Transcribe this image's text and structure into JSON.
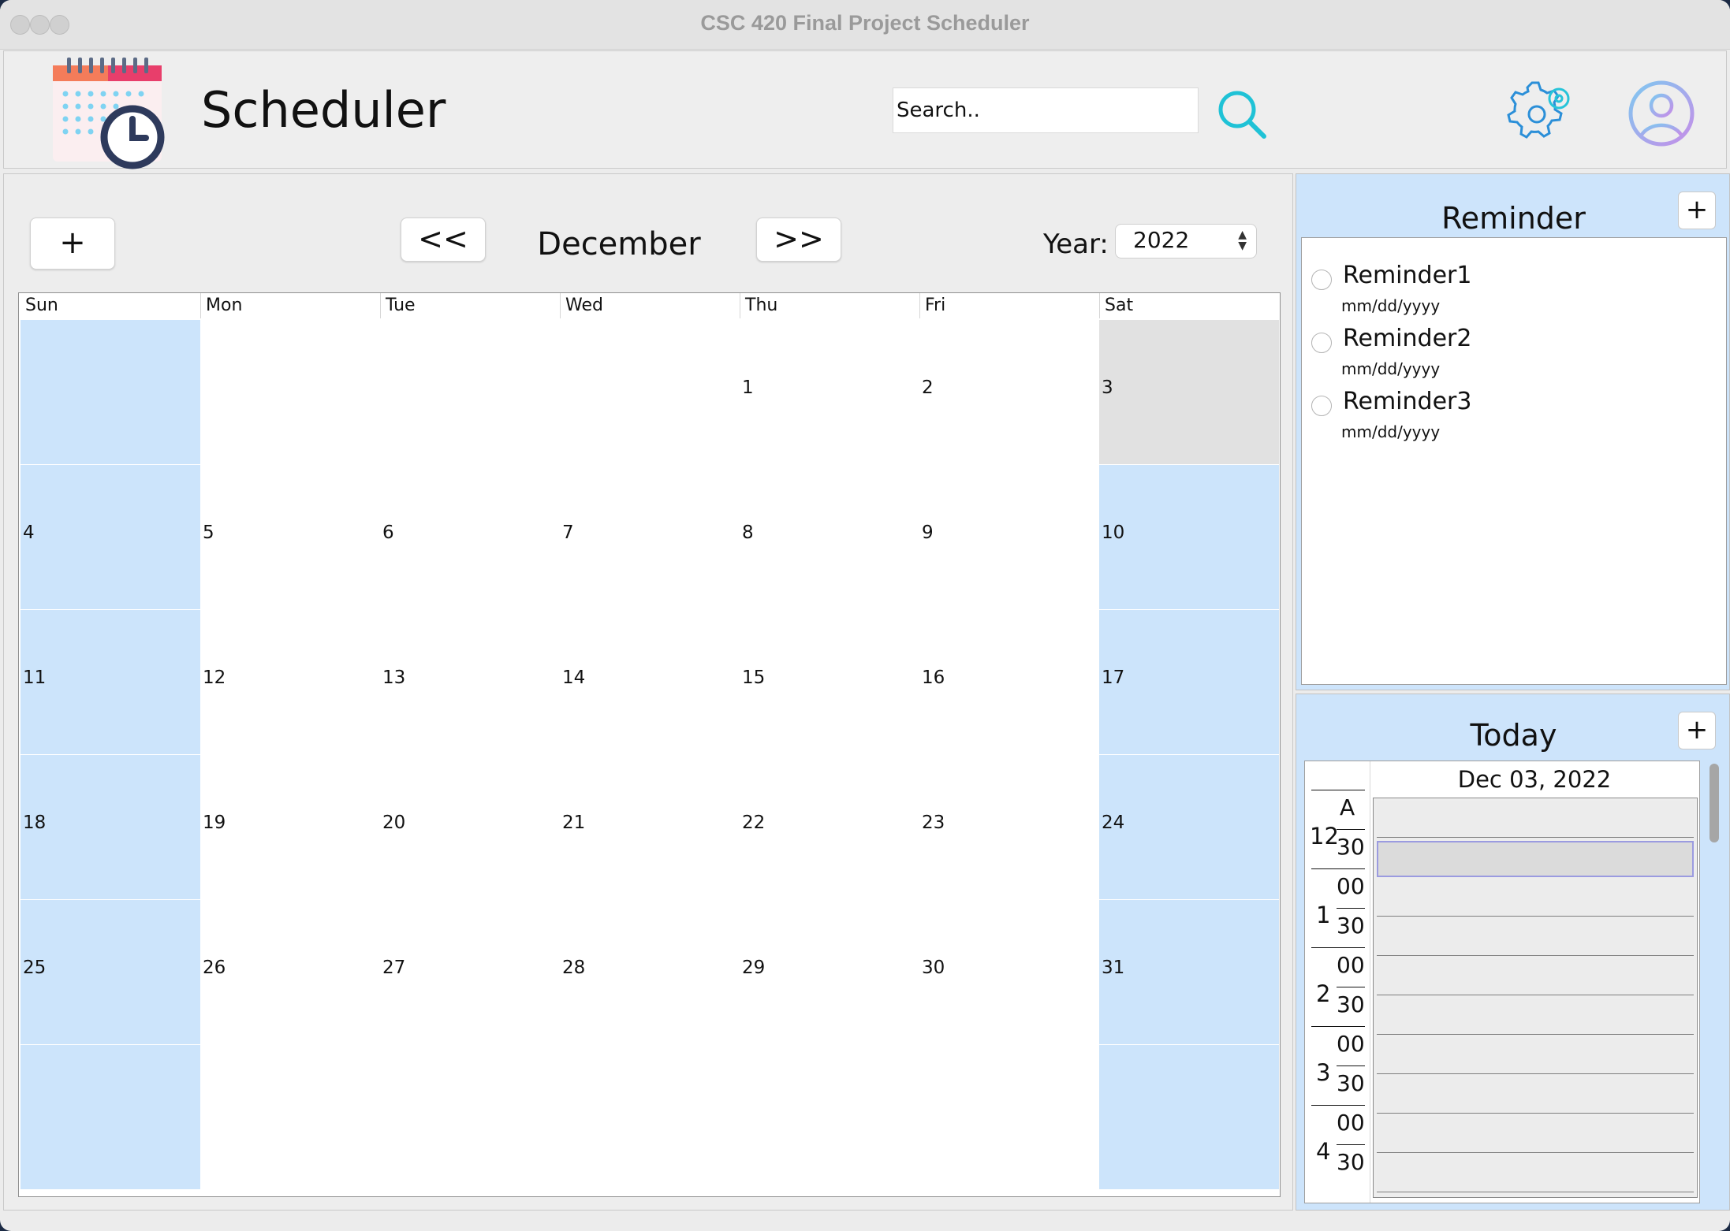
{
  "window": {
    "title": "CSC 420 Final Project Scheduler"
  },
  "header": {
    "app_title": "Scheduler",
    "search_placeholder": "Search..",
    "icons": {
      "logo": "calendar-clock-logo",
      "search": "search-icon",
      "settings": "gear-icon",
      "profile": "user-icon"
    }
  },
  "calendar": {
    "add_label": "+",
    "prev_label": "<<",
    "next_label": ">>",
    "month": "December",
    "year_label": "Year:",
    "year_value": "2022",
    "weekdays": [
      "Sun",
      "Mon",
      "Tue",
      "Wed",
      "Thu",
      "Fri",
      "Sat"
    ],
    "weeks": [
      [
        "",
        "",
        "",
        "",
        "1",
        "2",
        "3"
      ],
      [
        "4",
        "5",
        "6",
        "7",
        "8",
        "9",
        "10"
      ],
      [
        "11",
        "12",
        "13",
        "14",
        "15",
        "16",
        "17"
      ],
      [
        "18",
        "19",
        "20",
        "21",
        "22",
        "23",
        "24"
      ],
      [
        "25",
        "26",
        "27",
        "28",
        "29",
        "30",
        "31"
      ],
      [
        "",
        "",
        "",
        "",
        "",
        "",
        ""
      ]
    ],
    "selected_day": "3",
    "colors": {
      "weekend": "#cce4fb",
      "selected": "#e1e1e1"
    }
  },
  "reminders": {
    "title": "Reminder",
    "add_label": "+",
    "items": [
      {
        "name": "Reminder1",
        "date": "mm/dd/yyyy"
      },
      {
        "name": "Reminder2",
        "date": "mm/dd/yyyy"
      },
      {
        "name": "Reminder3",
        "date": "mm/dd/yyyy"
      }
    ]
  },
  "today": {
    "title": "Today",
    "add_label": "+",
    "date": "Dec 03, 2022",
    "hours": [
      "12",
      "1",
      "2",
      "3",
      "4"
    ],
    "first_hour_top": "A",
    "minute_top": "00",
    "minute_bottom": "30"
  }
}
